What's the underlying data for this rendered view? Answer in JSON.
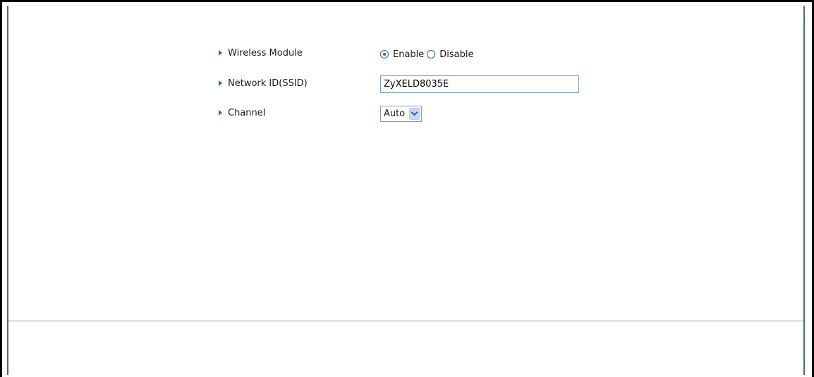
{
  "form": {
    "wireless_module": {
      "label": "Wireless Module",
      "options": [
        {
          "label": "Enable",
          "checked": true
        },
        {
          "label": "Disable",
          "checked": false
        }
      ]
    },
    "ssid": {
      "label": "Network ID(SSID)",
      "value": "ZyXELD8035E"
    },
    "channel": {
      "label": "Channel",
      "selected": "Auto"
    }
  },
  "colors": {
    "label_arrow": "#1f6fb8",
    "panel_border": "#4a6a8c",
    "checked_dot": "#2a7d2a"
  },
  "icons": {
    "row_marker": "triangle-right-icon",
    "dropdown": "chevron-down-icon"
  }
}
